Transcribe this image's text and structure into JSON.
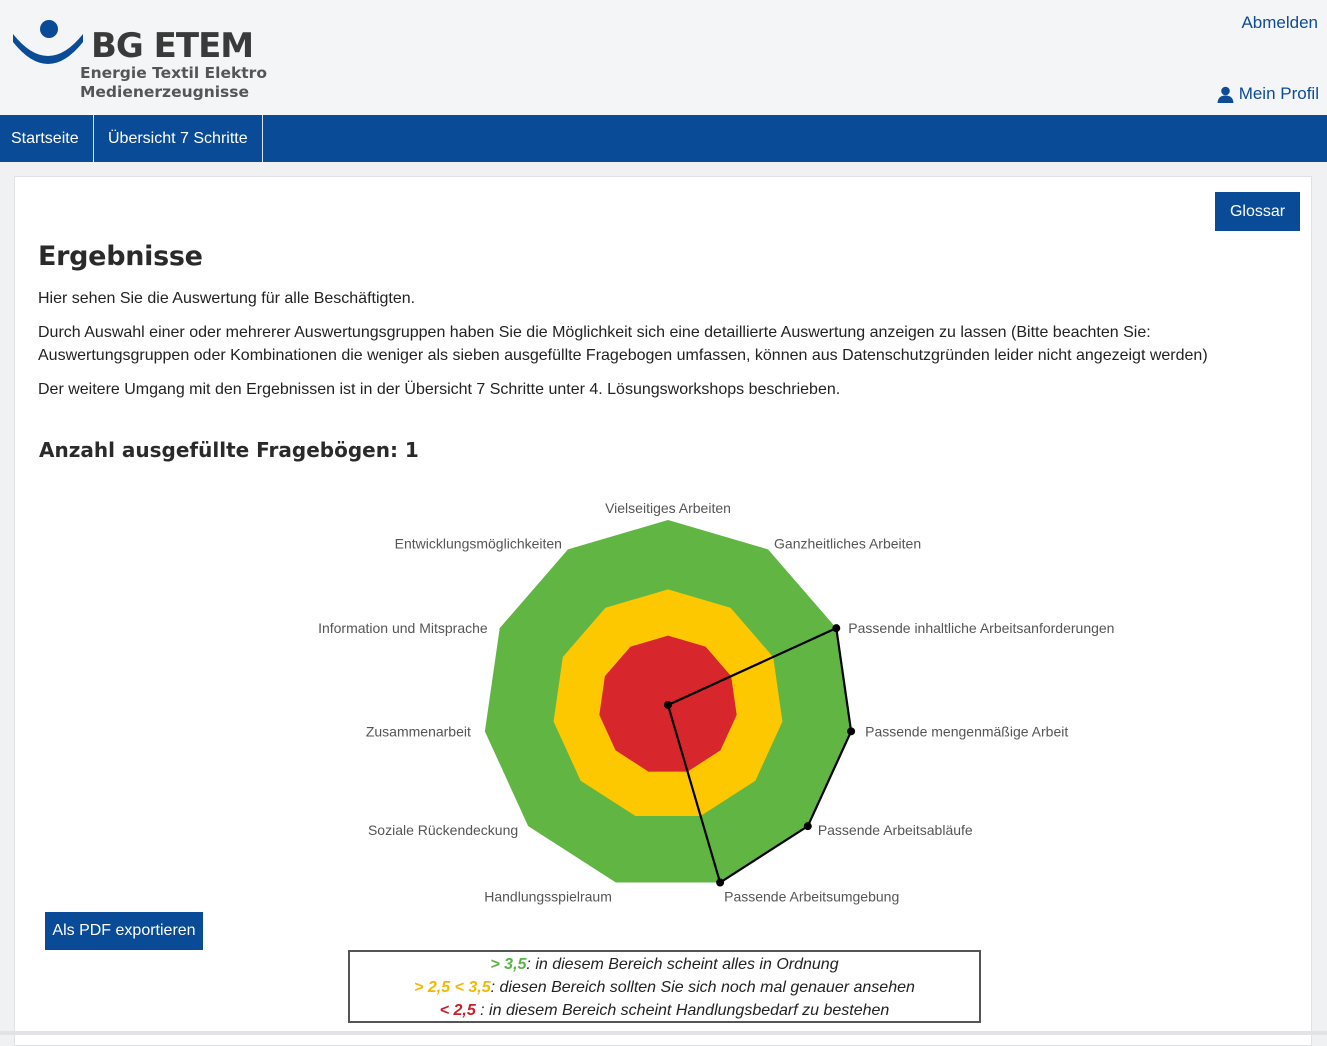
{
  "header": {
    "logo_title": "BG ETEM",
    "logo_sub_1": "Energie Textil Elektro",
    "logo_sub_2": "Medienerzeugnisse",
    "logout_label": "Abmelden",
    "profile_label": "Mein Profil",
    "brand_color": "#0a4b97"
  },
  "nav": {
    "items": [
      "Startseite",
      "Übersicht 7 Schritte"
    ]
  },
  "main": {
    "glossar_label": "Glossar",
    "title": "Ergebnisse",
    "para1": "Hier sehen Sie die Auswertung für alle Beschäftigten.",
    "para2": "Durch Auswahl einer oder mehrerer Auswertungsgruppen haben Sie die Möglichkeit sich eine detaillierte Auswertung anzeigen zu lassen (Bitte beachten Sie: Auswertungsgruppen oder Kombinationen die weniger als sieben ausgefüllte Fragebogen umfassen, können aus Datenschutzgründen leider nicht angezeigt werden)",
    "para3": "Der weitere Umgang mit den Ergebnissen ist in der Übersicht 7 Schritte unter 4. Lösungsworkshops beschrieben.",
    "count_heading": "Anzahl ausgefüllte Fragebögen: 1",
    "pdf_label": "Als PDF exportieren"
  },
  "legend": {
    "green_key": "> 3,5",
    "green_text": ": in diesem Bereich scheint alles in Ordnung",
    "yellow_key": "> 2,5 < 3,5",
    "yellow_text": ": diesen Bereich sollten Sie sich noch mal genauer ansehen",
    "red_key": "< 2,5",
    "red_text": " : in diesem Bereich scheint Handlungsbedarf zu bestehen"
  },
  "chart_data": {
    "type": "radar",
    "axes": [
      "Vielseitiges Arbeiten",
      "Ganzheitliches Arbeiten",
      "Passende inhaltliche Arbeitsanforderungen",
      "Passende mengenmäßige Arbeit",
      "Passende Arbeitsabläufe",
      "Passende Arbeitsumgebung",
      "Handlungsspielraum",
      "Soziale Rückendeckung",
      "Zusammenarbeit",
      "Information und Mitsprache",
      "Entwicklungsmöglichkeiten"
    ],
    "range": [
      1,
      5
    ],
    "bands": [
      {
        "min": 1,
        "max": 2.5,
        "color": "#d7262c"
      },
      {
        "min": 2.5,
        "max": 3.5,
        "color": "#fdc800"
      },
      {
        "min": 3.5,
        "max": 5,
        "color": "#60b543"
      }
    ],
    "series": [
      {
        "values": [
          null,
          null,
          5,
          5,
          5,
          5,
          null,
          null,
          null,
          null,
          null
        ],
        "color": "#000000"
      }
    ]
  }
}
